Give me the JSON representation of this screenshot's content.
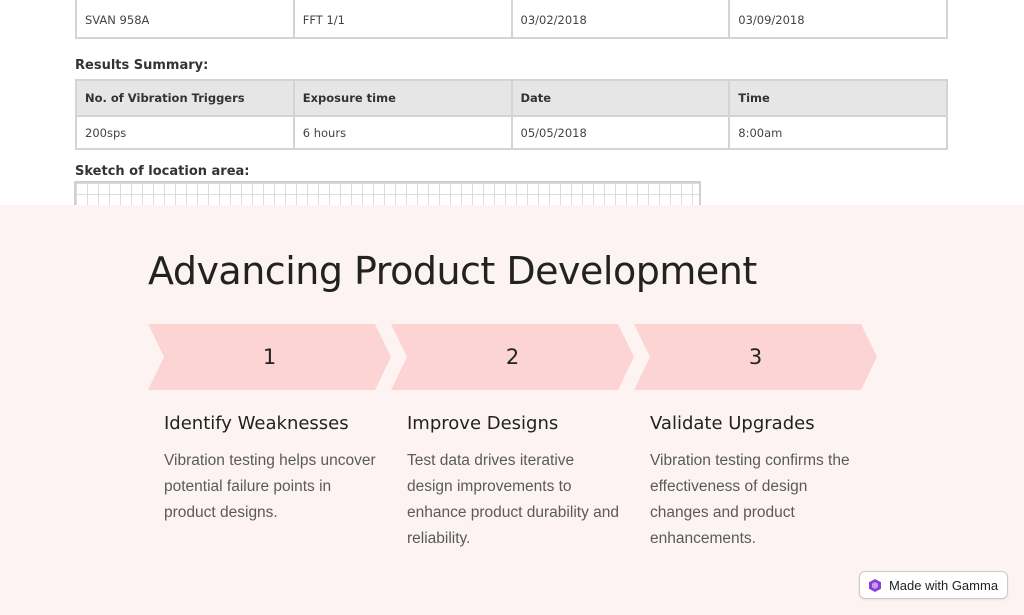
{
  "doc": {
    "top_row": [
      "SVAN 958A",
      "FFT 1/1",
      "03/02/2018",
      "03/09/2018"
    ],
    "results_heading": "Results Summary:",
    "results_headers": [
      "No. of Vibration Triggers",
      "Exposure time",
      "Date",
      "Time"
    ],
    "results_row": [
      "200sps",
      "6 hours",
      "05/05/2018",
      "8:00am"
    ],
    "sketch_heading": "Sketch of location area:"
  },
  "slide": {
    "title": "Advancing Product Development",
    "steps": [
      {
        "number": "1",
        "title": "Identify Weaknesses",
        "description": "Vibration testing helps uncover potential failure points in product designs."
      },
      {
        "number": "2",
        "title": "Improve Designs",
        "description": "Test data drives iterative design improvements to enhance product durability and reliability."
      },
      {
        "number": "3",
        "title": "Validate Upgrades",
        "description": "Vibration testing confirms the effectiveness of design changes and product enhancements."
      }
    ],
    "badge_label": "Made with Gamma"
  },
  "colors": {
    "background": "#fdf3f3",
    "chevron": "#fcd4d4",
    "gamma_icon": "#8b3fd1"
  },
  "icons": {
    "badge": "gamma-logo-icon"
  }
}
